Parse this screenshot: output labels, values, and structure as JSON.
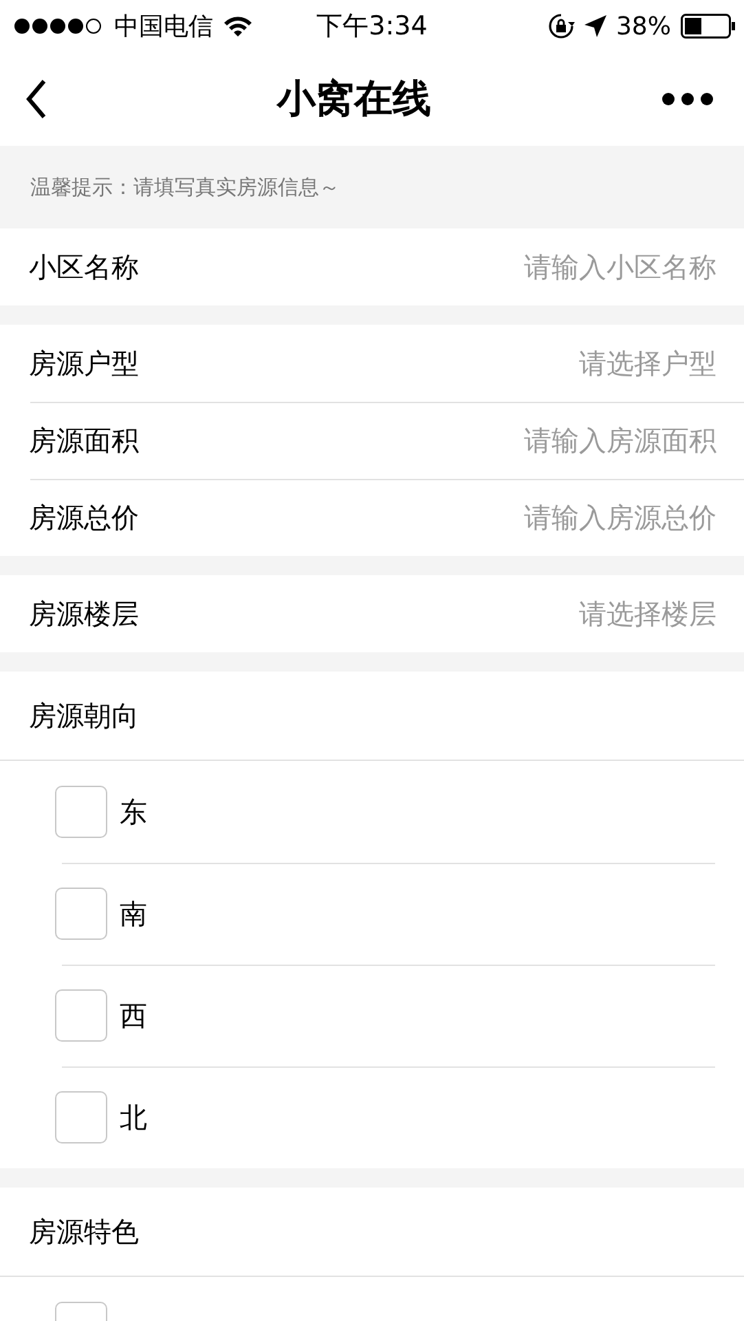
{
  "status_bar": {
    "carrier": "中国电信",
    "time": "下午3:34",
    "battery": "38%"
  },
  "nav": {
    "title": "小窝在线"
  },
  "tip": "温馨提示：请填写真实房源信息～",
  "groups": [
    {
      "kind": "fields",
      "fields": [
        {
          "label": "小区名称",
          "placeholder": "请输入小区名称"
        }
      ]
    },
    {
      "kind": "fields",
      "fields": [
        {
          "label": "房源户型",
          "placeholder": "请选择户型"
        },
        {
          "label": "房源面积",
          "placeholder": "请输入房源面积"
        },
        {
          "label": "房源总价",
          "placeholder": "请输入房源总价"
        }
      ]
    },
    {
      "kind": "fields",
      "fields": [
        {
          "label": "房源楼层",
          "placeholder": "请选择楼层"
        }
      ]
    },
    {
      "kind": "checkboxes",
      "label": "房源朝向",
      "options": [
        {
          "label": "东",
          "checked": false
        },
        {
          "label": "南",
          "checked": false
        },
        {
          "label": "西",
          "checked": false
        },
        {
          "label": "北",
          "checked": false
        }
      ]
    },
    {
      "kind": "checkboxes",
      "label": "房源特色",
      "options": [
        {
          "checked": false
        }
      ]
    }
  ]
}
